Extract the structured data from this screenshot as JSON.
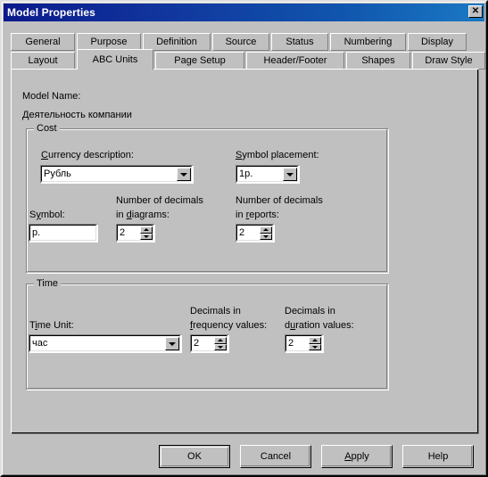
{
  "window": {
    "title": "Model Properties",
    "close_icon": "close-icon",
    "close_label": "✕"
  },
  "tabs": {
    "row1": [
      {
        "label": "General",
        "selected": false,
        "width": 72
      },
      {
        "label": "Purpose",
        "selected": false,
        "width": 72
      },
      {
        "label": "Definition",
        "selected": false,
        "width": 76
      },
      {
        "label": "Source",
        "selected": false,
        "width": 64
      },
      {
        "label": "Status",
        "selected": false,
        "width": 64
      },
      {
        "label": "Numbering",
        "selected": false,
        "width": 85
      },
      {
        "label": "Display",
        "selected": false,
        "width": 66
      }
    ],
    "row2": [
      {
        "label": "Layout",
        "selected": false,
        "width": 72
      },
      {
        "label": "ABC Units",
        "selected": true,
        "width": 86
      },
      {
        "label": "Page Setup",
        "selected": false,
        "width": 100
      },
      {
        "label": "Header/Footer",
        "selected": false,
        "width": 110
      },
      {
        "label": "Shapes",
        "selected": false,
        "width": 72
      },
      {
        "label": "Draw Style",
        "selected": false,
        "width": 82
      }
    ]
  },
  "content": {
    "model_name_label": "Model Name:",
    "model_name_value": "Деятельность компании",
    "cost_group": {
      "title": "Cost",
      "currency_description_label_pre": "C",
      "currency_description_label_post": "urrency description:",
      "currency_description_value": "Рубль",
      "symbol_placement_label_pre": "S",
      "symbol_placement_label_post": "ymbol placement:",
      "symbol_placement_value": "1р.",
      "symbol_label_pre": "S",
      "symbol_label_mid": "y",
      "symbol_label_post": "mbol:",
      "symbol_value": "р.",
      "decimals_diagrams_line1": "Number of decimals",
      "decimals_diagrams_line2_pre": "in ",
      "decimals_diagrams_line2_link": "d",
      "decimals_diagrams_line2_post": "iagrams:",
      "decimals_diagrams_value": "2",
      "decimals_reports_line1": "Number of decimals",
      "decimals_reports_line2_pre": "in ",
      "decimals_reports_line2_link": "r",
      "decimals_reports_line2_post": "eports:",
      "decimals_reports_value": "2"
    },
    "time_group": {
      "title": "Time",
      "time_unit_label_pre": "T",
      "time_unit_label_link": "i",
      "time_unit_label_post": "me Unit:",
      "time_unit_value": "час",
      "freq_decimals_line1": "Decimals in",
      "freq_decimals_line2_link": "f",
      "freq_decimals_line2_post": "requency values:",
      "freq_decimals_value": "2",
      "dur_decimals_line1": "Decimals in",
      "dur_decimals_line2_pre": "d",
      "dur_decimals_line2_link": "u",
      "dur_decimals_line2_post": "ration values:",
      "dur_decimals_value": "2"
    }
  },
  "buttons": {
    "ok": "OK",
    "cancel": "Cancel",
    "apply_pre": "A",
    "apply_post": "pply",
    "help": "Help"
  },
  "colors": {
    "face": "#c0c0c0",
    "title_left": "#0a1a8c",
    "title_right": "#1a79c4",
    "text": "#000000",
    "field_bg": "#ffffff"
  }
}
